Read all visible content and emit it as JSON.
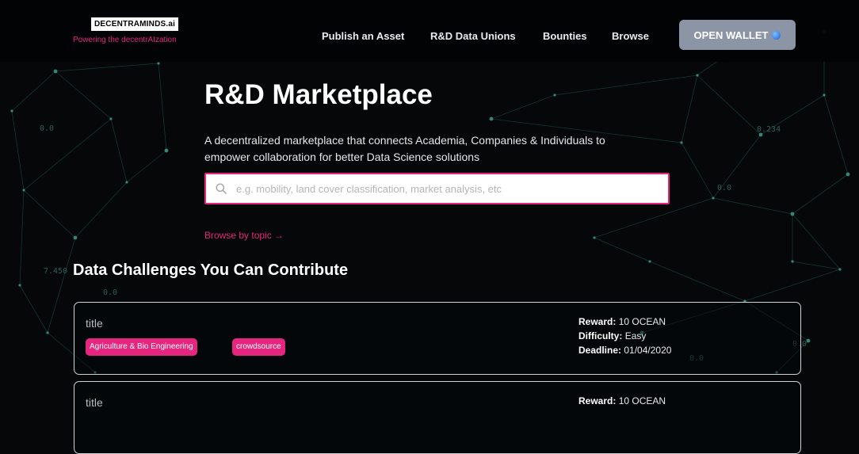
{
  "brand": {
    "logo": "DECENTRAMINDS.ai",
    "tagline": "Powering the decentrAIzation"
  },
  "nav": {
    "items": [
      "Publish an Asset",
      "R&D Data Unions",
      "Bounties",
      "Browse"
    ]
  },
  "wallet": {
    "label": "OPEN WALLET",
    "icon": "globe-icon"
  },
  "hero": {
    "title": "R&D Marketplace",
    "description_line1": "A decentralized marketplace that connects Academia, Companies & Individuals to",
    "description_line2": "empower collaboration for better Data Science solutions"
  },
  "search": {
    "placeholder": "e.g. mobility, land cover classification, market analysis, etc",
    "value": ""
  },
  "browse_topic": "Browse by topic →",
  "challenges": {
    "heading": "Data Challenges You Can Contribute",
    "items": [
      {
        "title": "title",
        "tags": [
          "Agriculture & Bio Engineering",
          "crowdsource"
        ],
        "reward_label": "Reward:",
        "reward": "10 OCEAN",
        "difficulty_label": "Difficulty:",
        "difficulty": "Easy",
        "deadline_label": "Deadline:",
        "deadline": "01/04/2020"
      },
      {
        "title": "title",
        "reward_label": "Reward:",
        "reward": "10 OCEAN"
      }
    ]
  },
  "background": {
    "labels": [
      "0.0",
      "7.450",
      "0.0",
      "0.0",
      "0.234",
      "0.0",
      "0.0"
    ]
  },
  "colors": {
    "accent": "#e6267e",
    "wallet_button": "#8c95a6",
    "background": "#050708"
  }
}
